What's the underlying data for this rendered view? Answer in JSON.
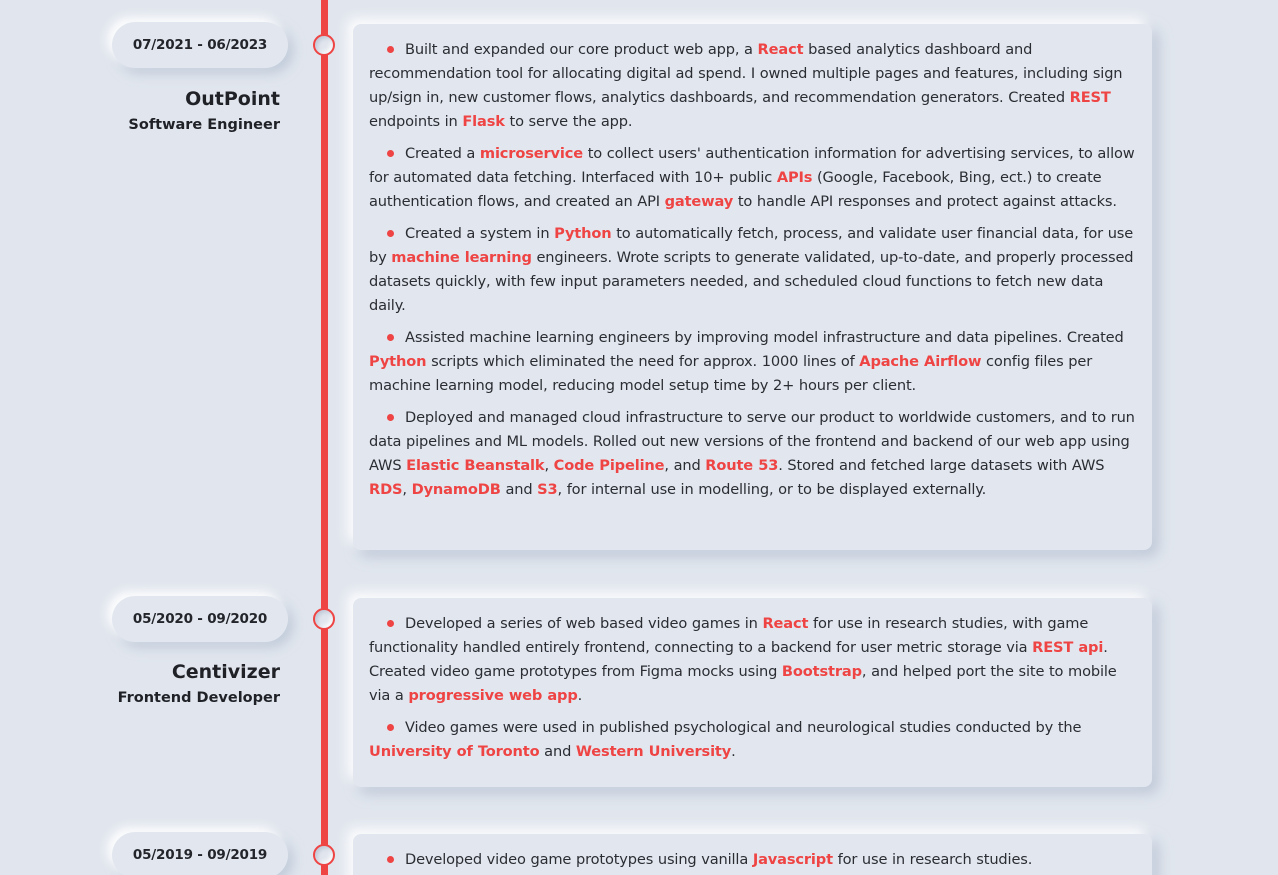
{
  "colors": {
    "accent": "#ef4444",
    "background": "#e1e6ee",
    "text": "#2b2d33"
  },
  "timeline": [
    {
      "dates": "07/2021 - 06/2023",
      "company": "OutPoint",
      "role": "Software Engineer",
      "bullets": [
        [
          {
            "t": "Built and expanded our core product web app, a "
          },
          {
            "t": "React",
            "h": true
          },
          {
            "t": " based analytics dashboard and recommendation tool for allocating digital ad spend. I owned multiple pages and features, including sign up/sign in, new customer flows, analytics dashboards, and recommendation generators. Created "
          },
          {
            "t": "REST",
            "h": true
          },
          {
            "t": " endpoints in "
          },
          {
            "t": "Flask",
            "h": true
          },
          {
            "t": " to serve the app."
          }
        ],
        [
          {
            "t": "Created a "
          },
          {
            "t": "microservice",
            "h": true
          },
          {
            "t": " to collect users' authentication information for advertising services, to allow for automated data fetching. Interfaced with 10+ public "
          },
          {
            "t": "APIs",
            "h": true
          },
          {
            "t": " (Google, Facebook, Bing, ect.) to create authentication flows, and created an API "
          },
          {
            "t": "gateway",
            "h": true
          },
          {
            "t": " to handle API responses and protect against attacks."
          }
        ],
        [
          {
            "t": "Created a system in "
          },
          {
            "t": "Python",
            "h": true
          },
          {
            "t": " to automatically fetch, process, and validate user financial data, for use by "
          },
          {
            "t": "machine learning",
            "h": true
          },
          {
            "t": " engineers. Wrote scripts to generate validated, up-to-date, and properly processed datasets quickly, with few input parameters needed, and scheduled cloud functions to fetch new data daily."
          }
        ],
        [
          {
            "t": "Assisted machine learning engineers by improving model infrastructure and data pipelines. Created "
          },
          {
            "t": "Python",
            "h": true
          },
          {
            "t": " scripts which eliminated the need for approx. 1000 lines of "
          },
          {
            "t": "Apache Airflow",
            "h": true
          },
          {
            "t": " config files per machine learning model, reducing model setup time by 2+ hours per client."
          }
        ],
        [
          {
            "t": "Deployed and managed cloud infrastructure to serve our product to worldwide customers, and to run data pipelines and ML models. Rolled out new versions of the frontend and backend of our web app using AWS "
          },
          {
            "t": "Elastic Beanstalk",
            "h": true
          },
          {
            "t": ", "
          },
          {
            "t": "Code Pipeline",
            "h": true
          },
          {
            "t": ", and "
          },
          {
            "t": "Route 53",
            "h": true
          },
          {
            "t": ". Stored and fetched large datasets with AWS "
          },
          {
            "t": "RDS",
            "h": true
          },
          {
            "t": ", "
          },
          {
            "t": "DynamoDB",
            "h": true
          },
          {
            "t": " and "
          },
          {
            "t": "S3",
            "h": true
          },
          {
            "t": ", for internal use in modelling, or to be displayed externally."
          }
        ]
      ]
    },
    {
      "dates": "05/2020 - 09/2020",
      "company": "Centivizer",
      "role": "Frontend Developer",
      "bullets": [
        [
          {
            "t": "Developed a series of web based video games in "
          },
          {
            "t": "React",
            "h": true
          },
          {
            "t": " for use in research studies, with game functionality handled entirely frontend, connecting to a backend for user metric storage via "
          },
          {
            "t": "REST api",
            "h": true
          },
          {
            "t": ". Created video game prototypes from Figma mocks using "
          },
          {
            "t": "Bootstrap",
            "h": true
          },
          {
            "t": ", and helped port the site to mobile via a "
          },
          {
            "t": "progressive web app",
            "h": true
          },
          {
            "t": "."
          }
        ],
        [
          {
            "t": "Video games were used in published psychological and neurological studies conducted by the "
          },
          {
            "t": "University of Toronto",
            "h": true
          },
          {
            "t": " and "
          },
          {
            "t": "Western University",
            "h": true
          },
          {
            "t": "."
          }
        ]
      ]
    },
    {
      "dates": "05/2019 - 09/2019",
      "company": "",
      "role": "",
      "bullets": [
        [
          {
            "t": "Developed video game prototypes using vanilla "
          },
          {
            "t": "Javascript",
            "h": true
          },
          {
            "t": " for use in research studies."
          }
        ]
      ]
    }
  ]
}
